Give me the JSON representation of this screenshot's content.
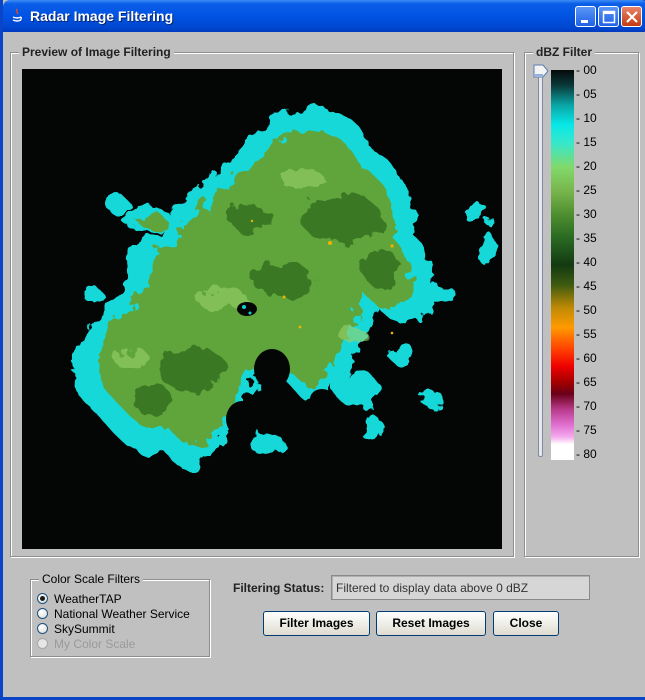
{
  "window": {
    "title": "Radar Image Filtering",
    "accent_color": "#0053e3",
    "controls": [
      "minimize-icon",
      "maximize-icon",
      "close-icon"
    ]
  },
  "preview": {
    "label": "Preview of Image Filtering",
    "background_color": "#030605"
  },
  "dbz_filter": {
    "label": "dBZ Filter",
    "scale_labels": [
      "- 00",
      "- 05",
      "- 10",
      "- 15",
      "- 20",
      "- 25",
      "- 30",
      "- 35",
      "- 40",
      "- 45",
      "- 50",
      "- 55",
      "- 60",
      "- 65",
      "- 70",
      "- 75",
      "- 80"
    ],
    "slider_value": 0
  },
  "color_scale_filters": {
    "label": "Color Scale Filters",
    "options": [
      {
        "label": "WeatherTAP",
        "selected": true,
        "enabled": true
      },
      {
        "label": "National Weather Service",
        "selected": false,
        "enabled": true
      },
      {
        "label": "SkySummit",
        "selected": false,
        "enabled": true
      },
      {
        "label": "My Color Scale",
        "selected": false,
        "enabled": false
      }
    ]
  },
  "status": {
    "label": "Filtering Status:",
    "value": "Filtered to display data above 0 dBZ"
  },
  "buttons": {
    "filter": "Filter Images",
    "reset": "Reset Images",
    "close": "Close"
  }
}
